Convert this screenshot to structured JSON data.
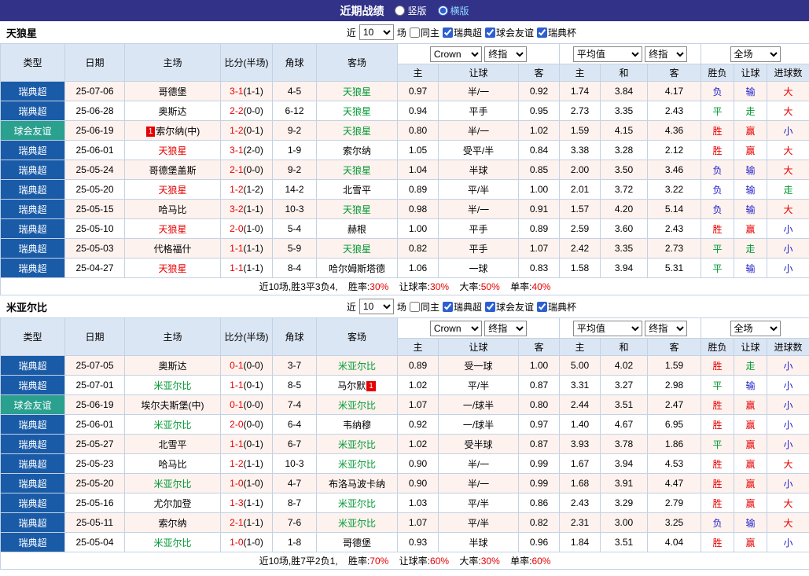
{
  "topbar": {
    "title": "近期战绩",
    "layout_options": [
      {
        "label": "竖版",
        "selected": false
      },
      {
        "label": "横版",
        "selected": true
      }
    ]
  },
  "filter_bar": {
    "recent_label": "近",
    "recent_value": "10",
    "matches_label": "场",
    "checkboxes": [
      {
        "label": "同主",
        "checked": false
      },
      {
        "label": "瑞典超",
        "checked": true
      },
      {
        "label": "球会友谊",
        "checked": true
      },
      {
        "label": "瑞典杯",
        "checked": true
      }
    ]
  },
  "header": {
    "selects": {
      "bookmaker": "Crown",
      "asia_final": "终指",
      "euro_average": "平均值",
      "euro_final": "终指",
      "scope": "全场"
    },
    "columns": {
      "type": "类型",
      "date": "日期",
      "home": "主场",
      "score": "比分(半场)",
      "corner": "角球",
      "away": "客场",
      "asia_home": "主",
      "asia_line": "让球",
      "asia_away": "客",
      "euro_home": "主",
      "euro_draw": "和",
      "euro_away": "客",
      "result": "胜负",
      "handicap": "让球",
      "goals": "进球数"
    }
  },
  "status_colors": {
    "win": "#e60000",
    "draw": "#009933",
    "loss": "#2121cc",
    "league": "#1a5ba8",
    "friendly": "#2aa08f"
  },
  "sections": [
    {
      "team": "天狼星",
      "rows": [
        {
          "league": "瑞典超",
          "league_class": "super",
          "date": "25-07-06",
          "home": "哥德堡",
          "home_color": "black",
          "score": "3-1",
          "half": "(1-1)",
          "corner": "4-5",
          "away": "天狼星",
          "away_color": "green",
          "asia": [
            "0.97",
            "半/一",
            "0.92"
          ],
          "euro": [
            "1.74",
            "3.84",
            "4.17"
          ],
          "outcome": [
            [
              "负",
              "blue"
            ],
            [
              "输",
              "blue"
            ],
            [
              "大",
              "red"
            ]
          ]
        },
        {
          "league": "瑞典超",
          "league_class": "super",
          "date": "25-06-28",
          "home": "奥斯达",
          "home_color": "black",
          "score": "2-2",
          "half": "(0-0)",
          "corner": "6-12",
          "away": "天狼星",
          "away_color": "green",
          "asia": [
            "0.94",
            "平手",
            "0.95"
          ],
          "euro": [
            "2.73",
            "3.35",
            "2.43"
          ],
          "outcome": [
            [
              "平",
              "green"
            ],
            [
              "走",
              "green"
            ],
            [
              "大",
              "red"
            ]
          ]
        },
        {
          "league": "球会友谊",
          "league_class": "friendly",
          "date": "25-06-19",
          "home": "索尔纳(中)",
          "home_color": "black",
          "home_badge": "1",
          "home_badge_pos": "before",
          "score": "1-2",
          "half": "(0-1)",
          "corner": "9-2",
          "away": "天狼星",
          "away_color": "green",
          "asia": [
            "0.80",
            "半/一",
            "1.02"
          ],
          "euro": [
            "1.59",
            "4.15",
            "4.36"
          ],
          "outcome": [
            [
              "胜",
              "red"
            ],
            [
              "赢",
              "red"
            ],
            [
              "小",
              "blue"
            ]
          ]
        },
        {
          "league": "瑞典超",
          "league_class": "super",
          "date": "25-06-01",
          "home": "天狼星",
          "home_color": "red",
          "score": "3-1",
          "half": "(2-0)",
          "corner": "1-9",
          "away": "索尔纳",
          "away_color": "black",
          "asia": [
            "1.05",
            "受平/半",
            "0.84"
          ],
          "euro": [
            "3.38",
            "3.28",
            "2.12"
          ],
          "outcome": [
            [
              "胜",
              "red"
            ],
            [
              "赢",
              "red"
            ],
            [
              "大",
              "red"
            ]
          ]
        },
        {
          "league": "瑞典超",
          "league_class": "super",
          "date": "25-05-24",
          "home": "哥德堡盖斯",
          "home_color": "black",
          "score": "2-1",
          "half": "(0-0)",
          "corner": "9-2",
          "away": "天狼星",
          "away_color": "green",
          "asia": [
            "1.04",
            "半球",
            "0.85"
          ],
          "euro": [
            "2.00",
            "3.50",
            "3.46"
          ],
          "outcome": [
            [
              "负",
              "blue"
            ],
            [
              "输",
              "blue"
            ],
            [
              "大",
              "red"
            ]
          ]
        },
        {
          "league": "瑞典超",
          "league_class": "super",
          "date": "25-05-20",
          "home": "天狼星",
          "home_color": "red",
          "score": "1-2",
          "half": "(1-2)",
          "corner": "14-2",
          "away": "北雪平",
          "away_color": "black",
          "asia": [
            "0.89",
            "平/半",
            "1.00"
          ],
          "euro": [
            "2.01",
            "3.72",
            "3.22"
          ],
          "outcome": [
            [
              "负",
              "blue"
            ],
            [
              "输",
              "blue"
            ],
            [
              "走",
              "green"
            ]
          ]
        },
        {
          "league": "瑞典超",
          "league_class": "super",
          "date": "25-05-15",
          "home": "哈马比",
          "home_color": "black",
          "score": "3-2",
          "half": "(1-1)",
          "corner": "10-3",
          "away": "天狼星",
          "away_color": "green",
          "asia": [
            "0.98",
            "半/一",
            "0.91"
          ],
          "euro": [
            "1.57",
            "4.20",
            "5.14"
          ],
          "outcome": [
            [
              "负",
              "blue"
            ],
            [
              "输",
              "blue"
            ],
            [
              "大",
              "red"
            ]
          ]
        },
        {
          "league": "瑞典超",
          "league_class": "super",
          "date": "25-05-10",
          "home": "天狼星",
          "home_color": "red",
          "score": "2-0",
          "half": "(1-0)",
          "corner": "5-4",
          "away": "赫根",
          "away_color": "black",
          "asia": [
            "1.00",
            "平手",
            "0.89"
          ],
          "euro": [
            "2.59",
            "3.60",
            "2.43"
          ],
          "outcome": [
            [
              "胜",
              "red"
            ],
            [
              "赢",
              "red"
            ],
            [
              "小",
              "blue"
            ]
          ]
        },
        {
          "league": "瑞典超",
          "league_class": "super",
          "date": "25-05-03",
          "home": "代格福什",
          "home_color": "black",
          "score": "1-1",
          "half": "(1-1)",
          "corner": "5-9",
          "away": "天狼星",
          "away_color": "green",
          "asia": [
            "0.82",
            "平手",
            "1.07"
          ],
          "euro": [
            "2.42",
            "3.35",
            "2.73"
          ],
          "outcome": [
            [
              "平",
              "green"
            ],
            [
              "走",
              "green"
            ],
            [
              "小",
              "blue"
            ]
          ]
        },
        {
          "league": "瑞典超",
          "league_class": "super",
          "date": "25-04-27",
          "home": "天狼星",
          "home_color": "red",
          "score": "1-1",
          "half": "(1-1)",
          "corner": "8-4",
          "away": "哈尔姆斯塔德",
          "away_color": "black",
          "asia": [
            "1.06",
            "一球",
            "0.83"
          ],
          "euro": [
            "1.58",
            "3.94",
            "5.31"
          ],
          "outcome": [
            [
              "平",
              "green"
            ],
            [
              "输",
              "blue"
            ],
            [
              "小",
              "blue"
            ]
          ]
        }
      ],
      "summary": {
        "prefix": "近10场,胜3平3负4,",
        "stats": [
          {
            "label": "胜率:",
            "value": "30%"
          },
          {
            "label": "让球率:",
            "value": "30%"
          },
          {
            "label": "大率:",
            "value": "50%"
          },
          {
            "label": "单率:",
            "value": "40%"
          }
        ]
      }
    },
    {
      "team": "米亚尔比",
      "rows": [
        {
          "league": "瑞典超",
          "league_class": "super",
          "date": "25-07-05",
          "home": "奥斯达",
          "home_color": "black",
          "score": "0-1",
          "half": "(0-0)",
          "corner": "3-7",
          "away": "米亚尔比",
          "away_color": "green",
          "asia": [
            "0.89",
            "受一球",
            "1.00"
          ],
          "euro": [
            "5.00",
            "4.02",
            "1.59"
          ],
          "outcome": [
            [
              "胜",
              "red"
            ],
            [
              "走",
              "green"
            ],
            [
              "小",
              "blue"
            ]
          ]
        },
        {
          "league": "瑞典超",
          "league_class": "super",
          "date": "25-07-01",
          "home": "米亚尔比",
          "home_color": "green",
          "score": "1-1",
          "half": "(0-1)",
          "corner": "8-5",
          "away": "马尔默",
          "away_color": "black",
          "away_badge": "1",
          "away_badge_pos": "after",
          "asia": [
            "1.02",
            "平/半",
            "0.87"
          ],
          "euro": [
            "3.31",
            "3.27",
            "2.98"
          ],
          "outcome": [
            [
              "平",
              "green"
            ],
            [
              "输",
              "blue"
            ],
            [
              "小",
              "blue"
            ]
          ]
        },
        {
          "league": "球会友谊",
          "league_class": "friendly",
          "date": "25-06-19",
          "home": "埃尔夫斯堡(中)",
          "home_color": "black",
          "score": "0-1",
          "half": "(0-0)",
          "corner": "7-4",
          "away": "米亚尔比",
          "away_color": "green",
          "asia": [
            "1.07",
            "一/球半",
            "0.80"
          ],
          "euro": [
            "2.44",
            "3.51",
            "2.47"
          ],
          "outcome": [
            [
              "胜",
              "red"
            ],
            [
              "赢",
              "red"
            ],
            [
              "小",
              "blue"
            ]
          ]
        },
        {
          "league": "瑞典超",
          "league_class": "super",
          "date": "25-06-01",
          "home": "米亚尔比",
          "home_color": "green",
          "score": "2-0",
          "half": "(0-0)",
          "corner": "6-4",
          "away": "韦纳穆",
          "away_color": "black",
          "asia": [
            "0.92",
            "一/球半",
            "0.97"
          ],
          "euro": [
            "1.40",
            "4.67",
            "6.95"
          ],
          "outcome": [
            [
              "胜",
              "red"
            ],
            [
              "赢",
              "red"
            ],
            [
              "小",
              "blue"
            ]
          ]
        },
        {
          "league": "瑞典超",
          "league_class": "super",
          "date": "25-05-27",
          "home": "北雪平",
          "home_color": "black",
          "score": "1-1",
          "half": "(0-1)",
          "corner": "6-7",
          "away": "米亚尔比",
          "away_color": "green",
          "asia": [
            "1.02",
            "受半球",
            "0.87"
          ],
          "euro": [
            "3.93",
            "3.78",
            "1.86"
          ],
          "outcome": [
            [
              "平",
              "green"
            ],
            [
              "赢",
              "red"
            ],
            [
              "小",
              "blue"
            ]
          ]
        },
        {
          "league": "瑞典超",
          "league_class": "super",
          "date": "25-05-23",
          "home": "哈马比",
          "home_color": "black",
          "score": "1-2",
          "half": "(1-1)",
          "corner": "10-3",
          "away": "米亚尔比",
          "away_color": "green",
          "asia": [
            "0.90",
            "半/一",
            "0.99"
          ],
          "euro": [
            "1.67",
            "3.94",
            "4.53"
          ],
          "outcome": [
            [
              "胜",
              "red"
            ],
            [
              "赢",
              "red"
            ],
            [
              "大",
              "red"
            ]
          ]
        },
        {
          "league": "瑞典超",
          "league_class": "super",
          "date": "25-05-20",
          "home": "米亚尔比",
          "home_color": "green",
          "score": "1-0",
          "half": "(1-0)",
          "corner": "4-7",
          "away": "布洛马波卡纳",
          "away_color": "black",
          "asia": [
            "0.90",
            "半/一",
            "0.99"
          ],
          "euro": [
            "1.68",
            "3.91",
            "4.47"
          ],
          "outcome": [
            [
              "胜",
              "red"
            ],
            [
              "赢",
              "red"
            ],
            [
              "小",
              "blue"
            ]
          ]
        },
        {
          "league": "瑞典超",
          "league_class": "super",
          "date": "25-05-16",
          "home": "尤尔加登",
          "home_color": "black",
          "score": "1-3",
          "half": "(1-1)",
          "corner": "8-7",
          "away": "米亚尔比",
          "away_color": "green",
          "asia": [
            "1.03",
            "平/半",
            "0.86"
          ],
          "euro": [
            "2.43",
            "3.29",
            "2.79"
          ],
          "outcome": [
            [
              "胜",
              "red"
            ],
            [
              "赢",
              "red"
            ],
            [
              "大",
              "red"
            ]
          ]
        },
        {
          "league": "瑞典超",
          "league_class": "super",
          "date": "25-05-11",
          "home": "索尔纳",
          "home_color": "black",
          "score": "2-1",
          "half": "(1-1)",
          "corner": "7-6",
          "away": "米亚尔比",
          "away_color": "green",
          "asia": [
            "1.07",
            "平/半",
            "0.82"
          ],
          "euro": [
            "2.31",
            "3.00",
            "3.25"
          ],
          "outcome": [
            [
              "负",
              "blue"
            ],
            [
              "输",
              "blue"
            ],
            [
              "大",
              "red"
            ]
          ]
        },
        {
          "league": "瑞典超",
          "league_class": "super",
          "date": "25-05-04",
          "home": "米亚尔比",
          "home_color": "green",
          "score": "1-0",
          "half": "(1-0)",
          "corner": "1-8",
          "away": "哥德堡",
          "away_color": "black",
          "asia": [
            "0.93",
            "半球",
            "0.96"
          ],
          "euro": [
            "1.84",
            "3.51",
            "4.04"
          ],
          "outcome": [
            [
              "胜",
              "red"
            ],
            [
              "赢",
              "red"
            ],
            [
              "小",
              "blue"
            ]
          ]
        }
      ],
      "summary": {
        "prefix": "近10场,胜7平2负1,",
        "stats": [
          {
            "label": "胜率:",
            "value": "70%"
          },
          {
            "label": "让球率:",
            "value": "60%"
          },
          {
            "label": "大率:",
            "value": "30%"
          },
          {
            "label": "单率:",
            "value": "60%"
          }
        ]
      }
    }
  ]
}
